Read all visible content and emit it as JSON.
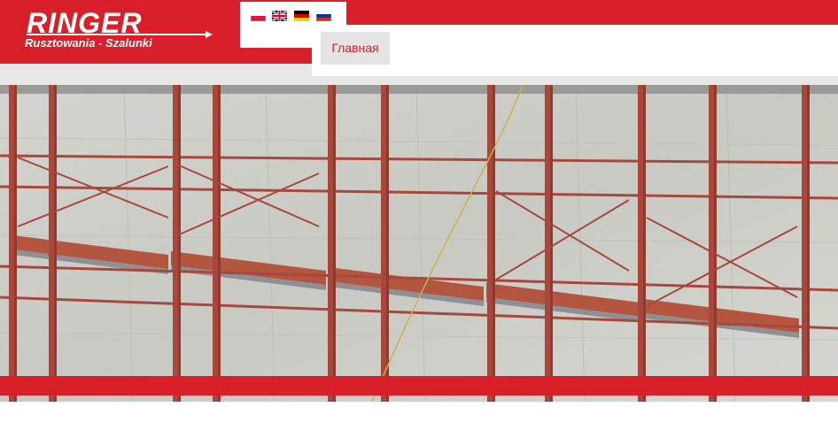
{
  "logo": {
    "title": "RINGER",
    "subtitle": "Rusztowania - Szalunki"
  },
  "languages": [
    {
      "code": "pl",
      "icon": "flag-poland-icon"
    },
    {
      "code": "en",
      "icon": "flag-uk-icon"
    },
    {
      "code": "de",
      "icon": "flag-germany-icon"
    },
    {
      "code": "ru",
      "icon": "flag-russia-icon"
    }
  ],
  "nav": {
    "items": [
      {
        "label": "Главная"
      }
    ]
  },
  "colors": {
    "brand_red": "#d9202a",
    "light_gray": "#e6e6e6",
    "nav_item_bg": "#e4e4e4"
  }
}
